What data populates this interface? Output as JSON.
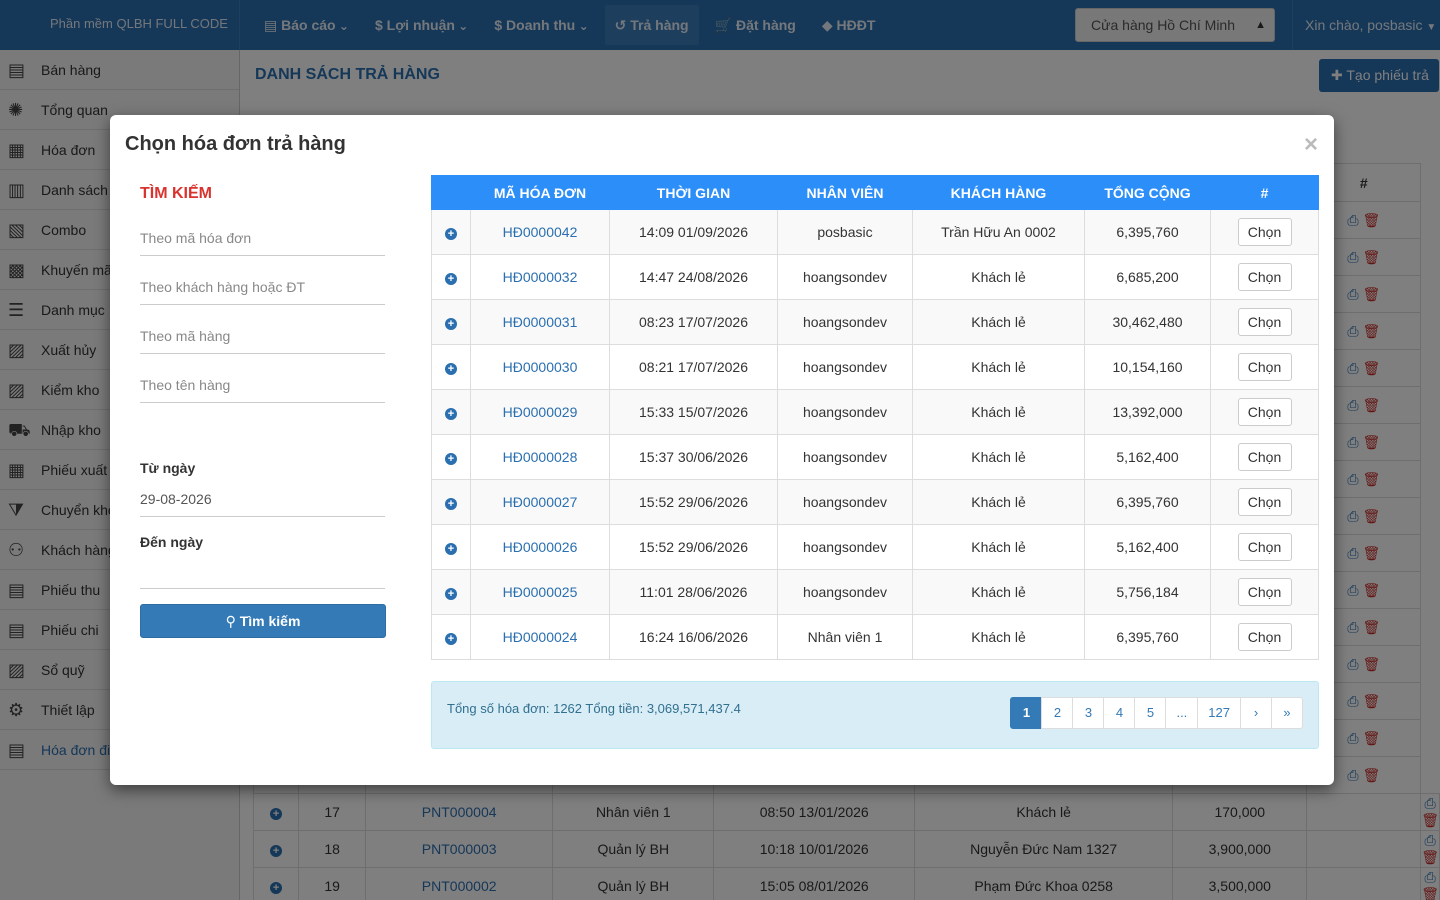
{
  "app": {
    "brand": "Phần mềm QLBH FULL CODE",
    "nav": [
      {
        "icon": "file-icon",
        "glyph": "▤",
        "label": "Báo cáo",
        "caret": true
      },
      {
        "icon": "dollar-icon",
        "glyph": "$",
        "label": "Lợi nhuận",
        "caret": true
      },
      {
        "icon": "dollar-icon",
        "glyph": "$",
        "label": "Doanh thu",
        "caret": true
      },
      {
        "icon": "undo-icon",
        "glyph": "↺",
        "label": "Trả hàng",
        "caret": false,
        "active": true
      },
      {
        "icon": "cart-icon",
        "glyph": "🛒",
        "label": "Đặt hàng",
        "caret": false
      },
      {
        "icon": "tag-icon",
        "glyph": "◆",
        "label": "HĐĐT",
        "caret": false
      }
    ],
    "store": "Cửa hàng Hồ Chí Minh",
    "greeting": "Xin chào, posbasic"
  },
  "sidebar": [
    {
      "label": "Bán hàng",
      "icon": "sale-icon"
    },
    {
      "label": "Tổng quan",
      "icon": "overview-icon"
    },
    {
      "label": "Hóa đơn",
      "icon": "invoice-icon"
    },
    {
      "label": "Danh sách",
      "icon": "list-icon"
    },
    {
      "label": "Combo",
      "icon": "combo-icon"
    },
    {
      "label": "Khuyến mã",
      "icon": "promo-icon"
    },
    {
      "label": "Danh mục",
      "icon": "menu-icon"
    },
    {
      "label": "Xuất hủy",
      "icon": "dispose-icon"
    },
    {
      "label": "Kiểm kho",
      "icon": "stock-check-icon"
    },
    {
      "label": "Nhập kho",
      "icon": "import-icon"
    },
    {
      "label": "Phiếu xuất",
      "icon": "export-icon"
    },
    {
      "label": "Chuyển kho",
      "icon": "filter-icon"
    },
    {
      "label": "Khách hàng",
      "icon": "customers-icon"
    },
    {
      "label": "Phiếu thu",
      "icon": "receipt-icon"
    },
    {
      "label": "Phiếu chi",
      "icon": "payment-icon"
    },
    {
      "label": "Sổ quỹ",
      "icon": "cashbook-icon"
    },
    {
      "label": "Thiết lập",
      "icon": "gear-icon"
    },
    {
      "label": "Hóa đơn đi",
      "icon": "e-invoice-icon",
      "active": true
    }
  ],
  "page": {
    "title": "DANH SÁCH TRẢ HÀNG",
    "create_label": "Tạo phiếu trả",
    "hash_header": "#",
    "background_rows": [
      {
        "no": "17",
        "code": "PNT000004",
        "staff": "Nhân viên 1",
        "time": "08:50 13/01/2026",
        "customer": "Khách lẻ",
        "total": "170,000"
      },
      {
        "no": "18",
        "code": "PNT000003",
        "staff": "Quản lý BH",
        "time": "10:18 10/01/2026",
        "customer": "Nguyễn Đức Nam 1327",
        "total": "3,900,000"
      },
      {
        "no": "19",
        "code": "PNT000002",
        "staff": "Quản lý BH",
        "time": "15:05 08/01/2026",
        "customer": "Phạm Đức Khoa 0258",
        "total": "3,500,000"
      }
    ]
  },
  "modal": {
    "title": "Chọn hóa đơn trả hàng",
    "close": "×",
    "search": {
      "heading": "TÌM KIẾM",
      "invoice_code_placeholder": "Theo mã hóa đơn",
      "customer_placeholder": "Theo khách hàng hoặc ĐT",
      "product_code_placeholder": "Theo mã hàng",
      "product_name_placeholder": "Theo tên hàng",
      "from_label": "Từ ngày",
      "from_value": "29-08-2026",
      "to_label": "Đến ngày",
      "to_value": "",
      "button": "Tìm kiếm"
    },
    "columns": [
      "",
      "MÃ HÓA ĐƠN",
      "THỜI GIAN",
      "NHÂN VIÊN",
      "KHÁCH HÀNG",
      "TỔNG CỘNG",
      "#"
    ],
    "select_label": "Chọn",
    "rows": [
      {
        "code": "HĐ0000042",
        "time": "14:09 01/09/2026",
        "staff": "posbasic",
        "customer": "Trần Hữu An 0002",
        "total": "6,395,760"
      },
      {
        "code": "HĐ0000032",
        "time": "14:47 24/08/2026",
        "staff": "hoangsondev",
        "customer": "Khách lẻ",
        "total": "6,685,200"
      },
      {
        "code": "HĐ0000031",
        "time": "08:23 17/07/2026",
        "staff": "hoangsondev",
        "customer": "Khách lẻ",
        "total": "30,462,480"
      },
      {
        "code": "HĐ0000030",
        "time": "08:21 17/07/2026",
        "staff": "hoangsondev",
        "customer": "Khách lẻ",
        "total": "10,154,160"
      },
      {
        "code": "HĐ0000029",
        "time": "15:33 15/07/2026",
        "staff": "hoangsondev",
        "customer": "Khách lẻ",
        "total": "13,392,000"
      },
      {
        "code": "HĐ0000028",
        "time": "15:37 30/06/2026",
        "staff": "hoangsondev",
        "customer": "Khách lẻ",
        "total": "5,162,400"
      },
      {
        "code": "HĐ0000027",
        "time": "15:52 29/06/2026",
        "staff": "hoangsondev",
        "customer": "Khách lẻ",
        "total": "6,395,760"
      },
      {
        "code": "HĐ0000026",
        "time": "15:52 29/06/2026",
        "staff": "hoangsondev",
        "customer": "Khách lẻ",
        "total": "5,162,400"
      },
      {
        "code": "HĐ0000025",
        "time": "11:01 28/06/2026",
        "staff": "hoangsondev",
        "customer": "Khách lẻ",
        "total": "5,756,184"
      },
      {
        "code": "HĐ0000024",
        "time": "16:24 16/06/2026",
        "staff": "Nhân viên 1",
        "customer": "Khách lẻ",
        "total": "6,395,760"
      }
    ],
    "summary": "Tổng số hóa đơn: 1262 Tổng tiền: 3,069,571,437.4",
    "pagination": [
      "1",
      "2",
      "3",
      "4",
      "5",
      "...",
      "127",
      "›",
      "»"
    ],
    "active_page": "1"
  },
  "colors": {
    "primary": "#2a6fb0",
    "table_header": "#2c8ef8",
    "search_heading": "#d9332f",
    "footer_bg": "#d9edf7"
  }
}
